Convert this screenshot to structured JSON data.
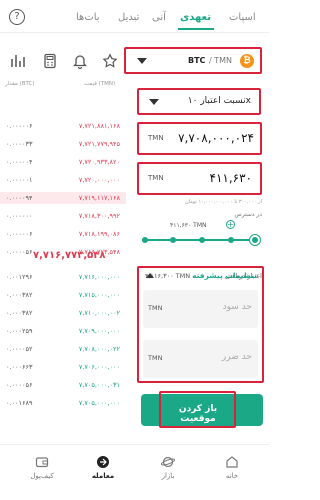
{
  "tabs": [
    {
      "label": "اسپات",
      "active": false
    },
    {
      "label": "تعهدی",
      "active": true
    },
    {
      "label": "آنی",
      "active": false
    },
    {
      "label": "تبدیل",
      "active": false
    },
    {
      "label": "بات‌ها",
      "active": false
    }
  ],
  "market": {
    "pair": "BTC",
    "quote": "/ TMN"
  },
  "leverage": {
    "label": "نسبت اعتبار ۱۰x"
  },
  "orderbook": {
    "header_price": "قیمت (TMN)",
    "header_amount": "مقدار (BTC)",
    "asks": [
      {
        "amount": "۰.۰۰۰۰۰۶",
        "price": "۷,۷۲۱,۸۸۱,۱۶۸"
      },
      {
        "amount": "۰.۰۰۰۰۳۳",
        "price": "۷,۷۲۱,۷۷۹,۹۴۵"
      },
      {
        "amount": "۰.۰۰۰۰۰۴",
        "price": "۷,۷۲۰,۹۳۳,۸۲۰"
      },
      {
        "amount": "۰.۰۰۰۰۰۱",
        "price": "۷,۷۲۰,۰۰۰,۰۰۰"
      },
      {
        "amount": "۰.۰۰۰۰۹۴",
        "price": "۷,۷۱۹,۱۱۷,۱۶۸"
      },
      {
        "amount": "۰.۰۰۰۰۰۰",
        "price": "۷,۷۱۸,۳۰۰,۹۹۲"
      },
      {
        "amount": "۰.۰۰۰۰۰۶",
        "price": "۷,۷۱۸,۱۹۹,۰۸۶"
      },
      {
        "amount": "۰.۰۰۰۰۵۶",
        "price": "۷,۷۱۶,۷۷۳,۵۴۸"
      }
    ],
    "last_price": "۷,۷۱۶,۷۷۲,۵۴۸",
    "bids": [
      {
        "amount": "۰.۰۰۱۲۹۶",
        "price": "۷,۷۱۶,۰۰۰,۰۰۰"
      },
      {
        "amount": "۰.۰۰۰۳۸۲",
        "price": "۷,۷۱۵,۰۰۰,۰۰۰"
      },
      {
        "amount": "۰.۰۰۰۳۸۲",
        "price": "۷,۷۱۰,۰۰۰,۰۰۲"
      },
      {
        "amount": "۰.۰۰۰۲۵۹",
        "price": "۷,۷۰۹,۰۰۰,۰۰۰"
      },
      {
        "amount": "۰.۰۰۰۰۵۲",
        "price": "۷,۷۰۸,۰۰۰,۰۲۲"
      },
      {
        "amount": "۰.۰۰۰۶۶۳",
        "price": "۷,۷۰۶,۰۰۰,۰۰۰"
      },
      {
        "amount": "۰.۰۰۰۰۵۶",
        "price": "۷,۷۰۵,۰۰۰,۰۳۱"
      },
      {
        "amount": "۰.۰۰۱۶۸۹",
        "price": "۷,۷۰۵,۰۰۰,۰۰۰"
      }
    ]
  },
  "price_field": {
    "unit": "TMN",
    "value": "۷,۷۰۸,۰۰۰,۰۲۴"
  },
  "amount_field": {
    "unit": "TMN",
    "value": "۴۱۱,۶۳۰"
  },
  "min_note": "از ۳۰۰,۰۰۰ تا ۱۰,۰۰۰,۰۰۰,۰۰۰ تومان",
  "available": {
    "label": "در دسترس",
    "value": "۴۱۱,۶۳۰ TMN"
  },
  "slider_percent": 100,
  "received_credit": {
    "label": "اعتبار دریافتی",
    "value": "۴,۱۱۶,۳۰۰ TMN"
  },
  "advanced": {
    "title": "تنظیمات پیشرفته",
    "tp": {
      "unit": "TMN",
      "placeholder": "حد سود"
    },
    "sl": {
      "unit": "TMN",
      "placeholder": "حد ضرر"
    }
  },
  "open_button": "باز کردن موقعیت",
  "nav": [
    {
      "label": "خانه",
      "icon": "home-icon"
    },
    {
      "label": "بازار",
      "icon": "market-icon"
    },
    {
      "label": "معامله",
      "icon": "trade-icon",
      "active": true
    },
    {
      "label": "کیف‌پول",
      "icon": "wallet-icon"
    }
  ],
  "colors": {
    "accent": "#1aa887",
    "ask": "#e03d52",
    "bid": "#1aa887",
    "highlight": "#d9233b"
  }
}
